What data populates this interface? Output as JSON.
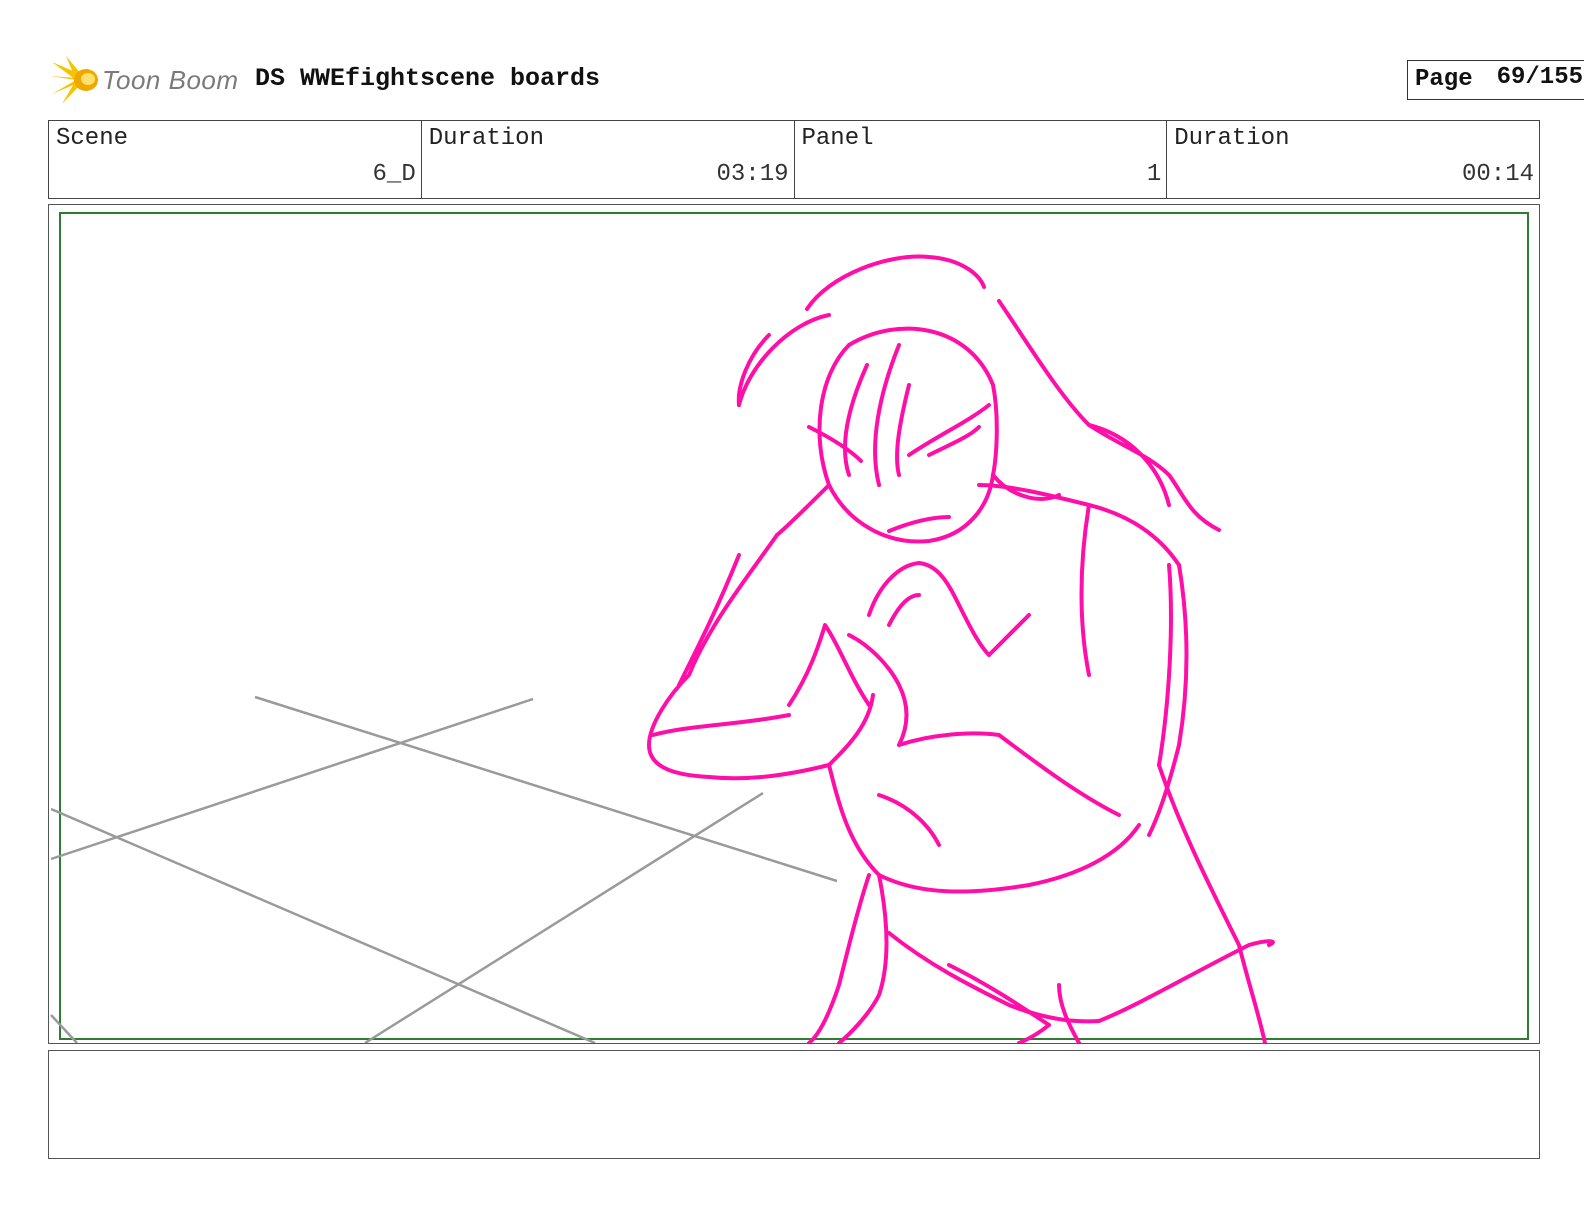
{
  "header": {
    "logo_text": "Toon Boom",
    "title": "DS WWEfightscene boards",
    "page_label": "Page",
    "page_value": "69/155"
  },
  "info": [
    {
      "label": "Scene",
      "value": "6_D"
    },
    {
      "label": "Duration",
      "value": "03:19"
    },
    {
      "label": "Panel",
      "value": "1"
    },
    {
      "label": "Duration",
      "value": "00:14"
    }
  ],
  "colors": {
    "sketch": "#ff0fa8",
    "floor_lines": "#9a9a9a",
    "safe_frame": "#2e7d32",
    "logo_star": "#f5c400"
  },
  "icons": {
    "logo": "toon-boom-starburst-icon"
  }
}
